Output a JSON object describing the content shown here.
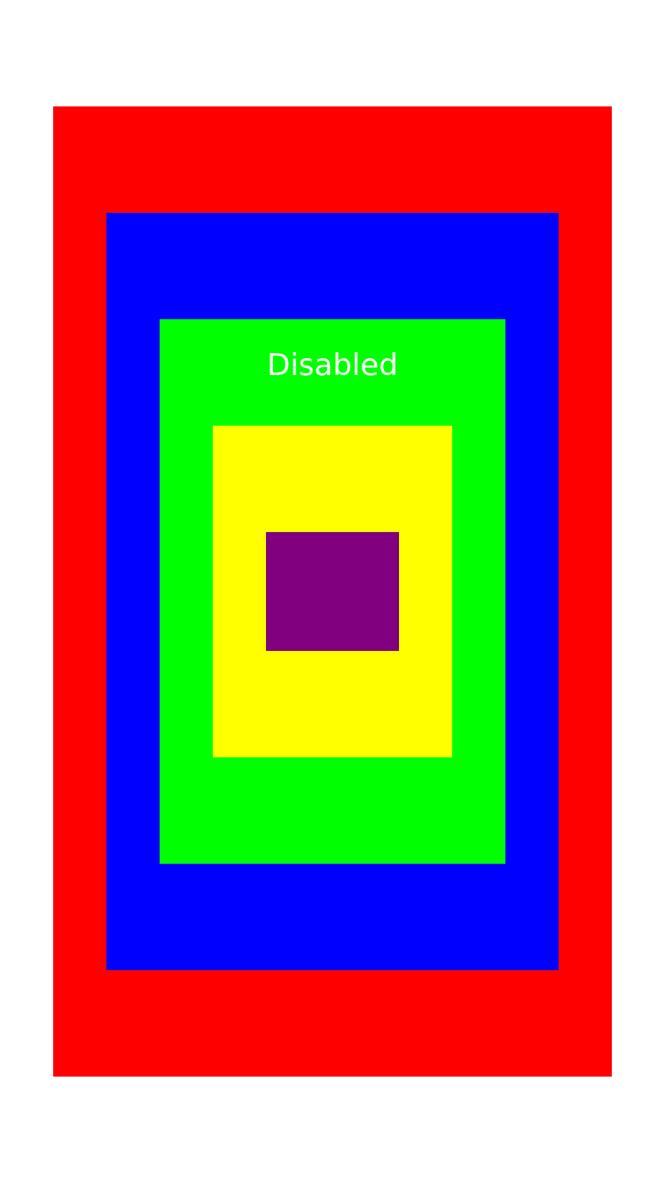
{
  "colors": {
    "background": "#ffffff",
    "outer": "#ff0000",
    "second": "#0000ff",
    "third": "#00ff00",
    "fourth": "#ffff00",
    "inner": "#800080",
    "label": "#ffffff"
  },
  "label": {
    "text": "Disabled",
    "state": "disabled"
  }
}
